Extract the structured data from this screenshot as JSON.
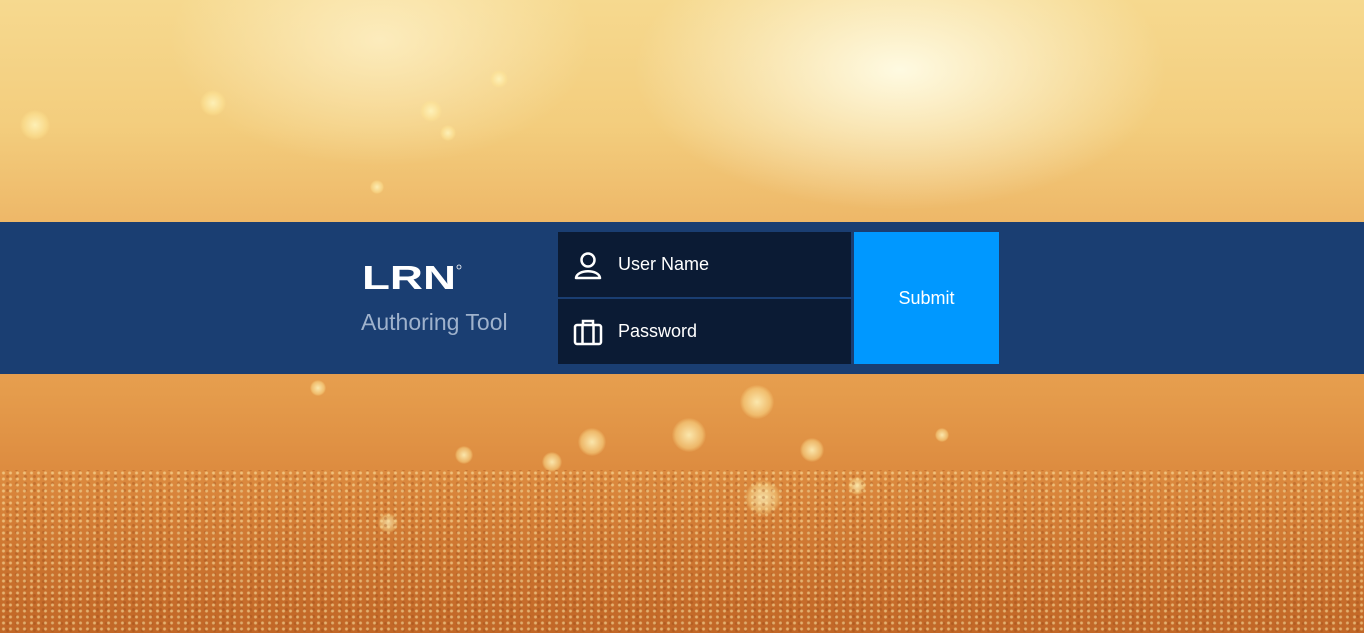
{
  "brand": {
    "logo_text": "LRN",
    "subtitle": "Authoring Tool"
  },
  "login": {
    "username_placeholder": "User Name",
    "password_placeholder": "Password",
    "submit_label": "Submit"
  },
  "colors": {
    "band": "#1a3e72",
    "field_bg": "#0b1b34",
    "submit_bg": "#0098ff",
    "subtitle": "#9fb2cc"
  },
  "icons": {
    "username": "user-icon",
    "password": "briefcase-icon"
  }
}
